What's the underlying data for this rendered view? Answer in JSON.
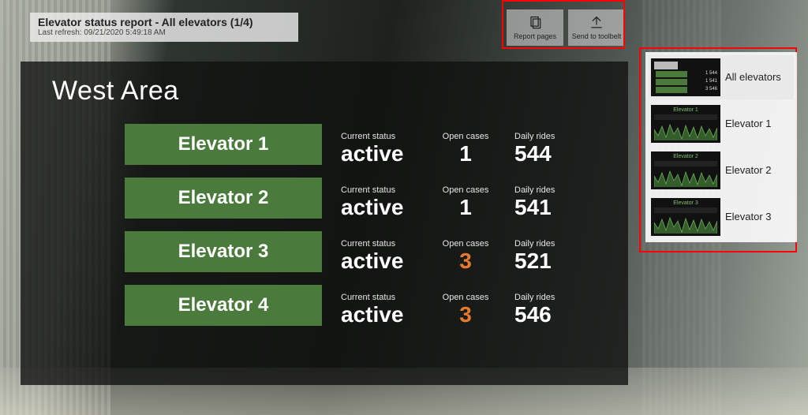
{
  "header": {
    "title": "Elevator status report - All elevators (1/4)",
    "last_refresh_label": "Last refresh: 09/21/2020 5:49:18 AM"
  },
  "toolbar": {
    "report_pages_label": "Report pages",
    "send_toolbelt_label": "Send to toolbelt"
  },
  "panel": {
    "area_title": "West Area",
    "column_labels": {
      "status": "Current status",
      "cases": "Open cases",
      "rides": "Daily rides"
    },
    "rows": [
      {
        "name": "Elevator 1",
        "status": "active",
        "open_cases": "1",
        "open_cases_warn": false,
        "daily_rides": "544"
      },
      {
        "name": "Elevator 2",
        "status": "active",
        "open_cases": "1",
        "open_cases_warn": false,
        "daily_rides": "541"
      },
      {
        "name": "Elevator 3",
        "status": "active",
        "open_cases": "3",
        "open_cases_warn": true,
        "daily_rides": "521"
      },
      {
        "name": "Elevator 4",
        "status": "active",
        "open_cases": "3",
        "open_cases_warn": true,
        "daily_rides": "546"
      }
    ]
  },
  "pages": [
    {
      "label": "All elevators",
      "kind": "all",
      "selected": true
    },
    {
      "label": "Elevator 1",
      "kind": "chart",
      "selected": false
    },
    {
      "label": "Elevator 2",
      "kind": "chart",
      "selected": false
    },
    {
      "label": "Elevator 3",
      "kind": "chart",
      "selected": false
    }
  ],
  "colors": {
    "chip_bg": "#4a7a3c",
    "warn": "#e67a2e",
    "highlight": "#ff0000"
  }
}
